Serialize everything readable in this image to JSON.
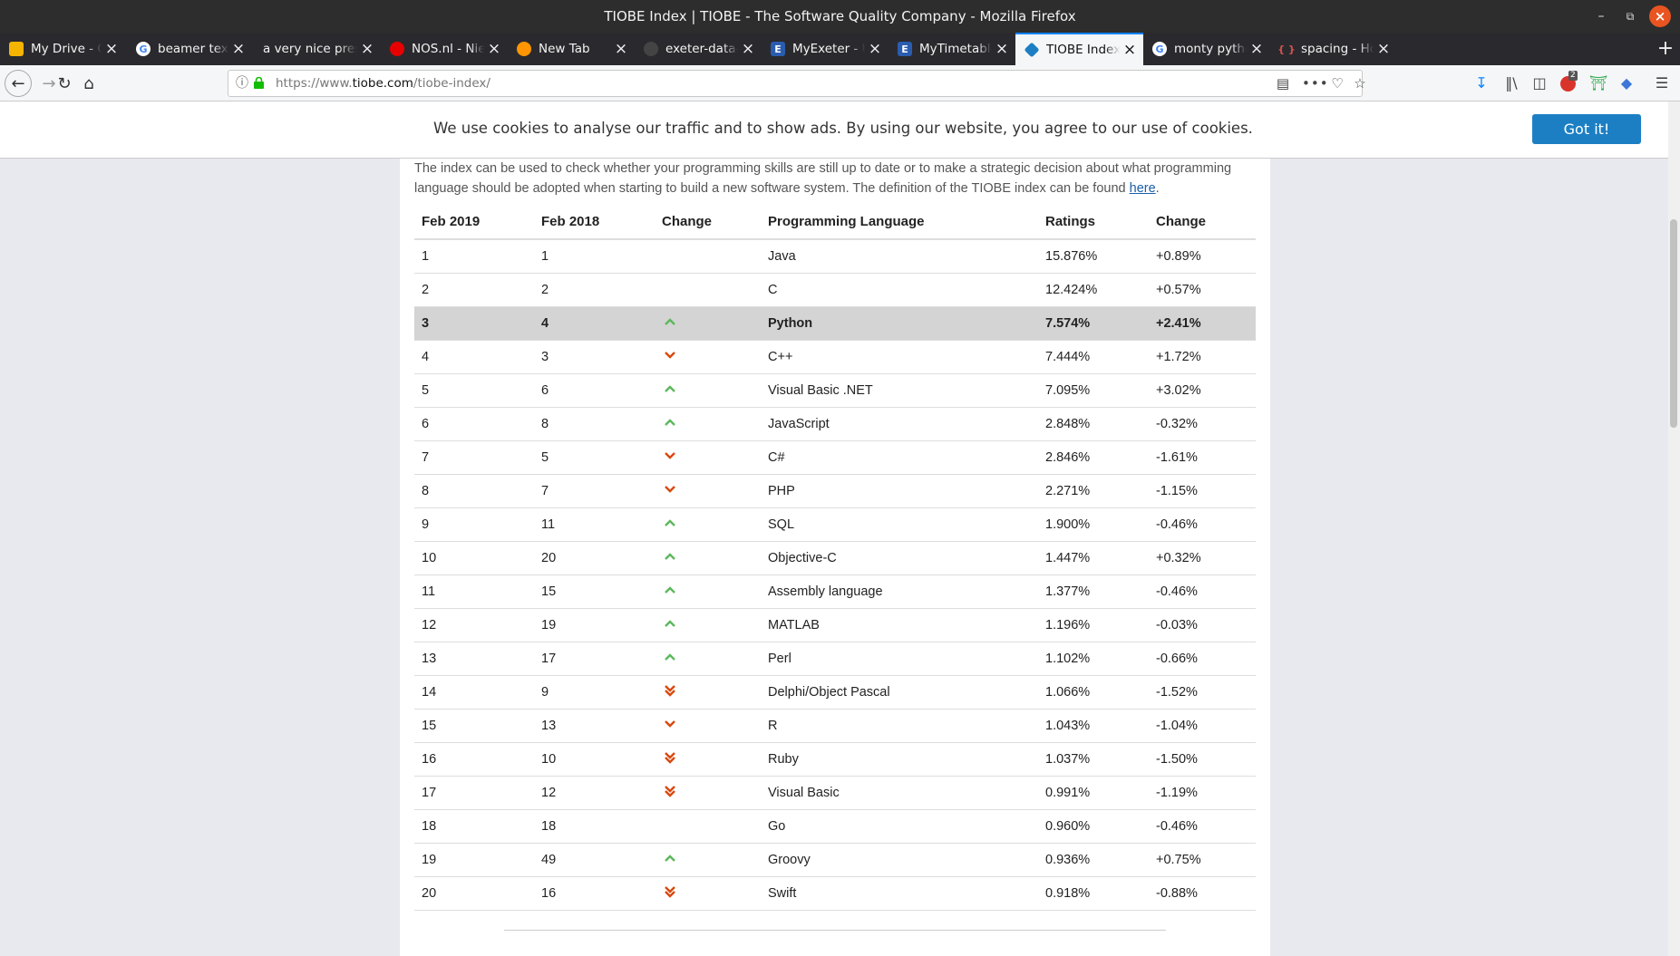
{
  "window": {
    "title": "TIOBE Index | TIOBE - The Software Quality Company - Mozilla Firefox"
  },
  "tabs": [
    {
      "label": "My Drive - Google Drive",
      "icon": "drive-icon",
      "fav_bg": "#f4b400"
    },
    {
      "label": "beamer tex - Google Search",
      "icon": "google-icon",
      "fav_bg": "#ffffff"
    },
    {
      "label": "a very nice presentation",
      "icon": "none",
      "fav_bg": ""
    },
    {
      "label": "NOS.nl - Nieuws, Sport",
      "icon": "nos-icon",
      "fav_bg": "#e60000"
    },
    {
      "label": "New Tab",
      "icon": "firefox-icon",
      "fav_bg": "#ff9500"
    },
    {
      "label": "exeter-data-analytics",
      "icon": "github-icon",
      "fav_bg": "#444444"
    },
    {
      "label": "MyExeter - University",
      "icon": "exeter-icon",
      "fav_bg": "#2a5db0"
    },
    {
      "label": "MyTimetable - University",
      "icon": "exeter-icon",
      "fav_bg": "#2a5db0"
    },
    {
      "label": "TIOBE Index | TIOBE",
      "icon": "tiobe-icon",
      "fav_bg": "#1c7fc4"
    },
    {
      "label": "monty python flying",
      "icon": "google-icon",
      "fav_bg": "#ffffff"
    },
    {
      "label": "spacing - How do I",
      "icon": "stackexchange-icon",
      "fav_bg": "#d9534f"
    }
  ],
  "nav": {
    "url_prefix": "https://www.",
    "url_domain": "tiobe.com",
    "url_path": "/tiobe-index/",
    "adblock_count": "2"
  },
  "cookie": {
    "message": "We use cookies to analyse our traffic and to show ads. By using our website, you agree to our use of cookies.",
    "button": "Got it!"
  },
  "intro": {
    "text": "The index can be used to check whether your programming skills are still up to date or to make a strategic decision about what programming language should be adopted when starting to build a new software system. The definition of the TIOBE index can be found ",
    "link": "here",
    "end": "."
  },
  "table": {
    "headers": [
      "Feb 2019",
      "Feb 2018",
      "Change",
      "Programming Language",
      "Ratings",
      "Change"
    ],
    "rows": [
      {
        "r2019": "1",
        "r2018": "1",
        "change": "none",
        "lang": "Java",
        "rating": "15.876%",
        "delta": "+0.89%"
      },
      {
        "r2019": "2",
        "r2018": "2",
        "change": "none",
        "lang": "C",
        "rating": "12.424%",
        "delta": "+0.57%"
      },
      {
        "r2019": "3",
        "r2018": "4",
        "change": "up",
        "lang": "Python",
        "rating": "7.574%",
        "delta": "+2.41%",
        "highlight": true
      },
      {
        "r2019": "4",
        "r2018": "3",
        "change": "down",
        "lang": "C++",
        "rating": "7.444%",
        "delta": "+1.72%"
      },
      {
        "r2019": "5",
        "r2018": "6",
        "change": "up",
        "lang": "Visual Basic .NET",
        "rating": "7.095%",
        "delta": "+3.02%"
      },
      {
        "r2019": "6",
        "r2018": "8",
        "change": "up",
        "lang": "JavaScript",
        "rating": "2.848%",
        "delta": "-0.32%"
      },
      {
        "r2019": "7",
        "r2018": "5",
        "change": "down",
        "lang": "C#",
        "rating": "2.846%",
        "delta": "-1.61%"
      },
      {
        "r2019": "8",
        "r2018": "7",
        "change": "down",
        "lang": "PHP",
        "rating": "2.271%",
        "delta": "-1.15%"
      },
      {
        "r2019": "9",
        "r2018": "11",
        "change": "up",
        "lang": "SQL",
        "rating": "1.900%",
        "delta": "-0.46%"
      },
      {
        "r2019": "10",
        "r2018": "20",
        "change": "upup",
        "lang": "Objective-C",
        "rating": "1.447%",
        "delta": "+0.32%"
      },
      {
        "r2019": "11",
        "r2018": "15",
        "change": "upup",
        "lang": "Assembly language",
        "rating": "1.377%",
        "delta": "-0.46%"
      },
      {
        "r2019": "12",
        "r2018": "19",
        "change": "upup",
        "lang": "MATLAB",
        "rating": "1.196%",
        "delta": "-0.03%"
      },
      {
        "r2019": "13",
        "r2018": "17",
        "change": "upup",
        "lang": "Perl",
        "rating": "1.102%",
        "delta": "-0.66%"
      },
      {
        "r2019": "14",
        "r2018": "9",
        "change": "downdown",
        "lang": "Delphi/Object Pascal",
        "rating": "1.066%",
        "delta": "-1.52%"
      },
      {
        "r2019": "15",
        "r2018": "13",
        "change": "down",
        "lang": "R",
        "rating": "1.043%",
        "delta": "-1.04%"
      },
      {
        "r2019": "16",
        "r2018": "10",
        "change": "downdown",
        "lang": "Ruby",
        "rating": "1.037%",
        "delta": "-1.50%"
      },
      {
        "r2019": "17",
        "r2018": "12",
        "change": "downdown",
        "lang": "Visual Basic",
        "rating": "0.991%",
        "delta": "-1.19%"
      },
      {
        "r2019": "18",
        "r2018": "18",
        "change": "none",
        "lang": "Go",
        "rating": "0.960%",
        "delta": "-0.46%"
      },
      {
        "r2019": "19",
        "r2018": "49",
        "change": "upup",
        "lang": "Groovy",
        "rating": "0.936%",
        "delta": "+0.75%"
      },
      {
        "r2019": "20",
        "r2018": "16",
        "change": "downdown",
        "lang": "Swift",
        "rating": "0.918%",
        "delta": "-0.88%"
      }
    ]
  },
  "colors": {
    "up": "#5cb85c",
    "down": "#d9480f",
    "accent": "#0a84ff"
  }
}
